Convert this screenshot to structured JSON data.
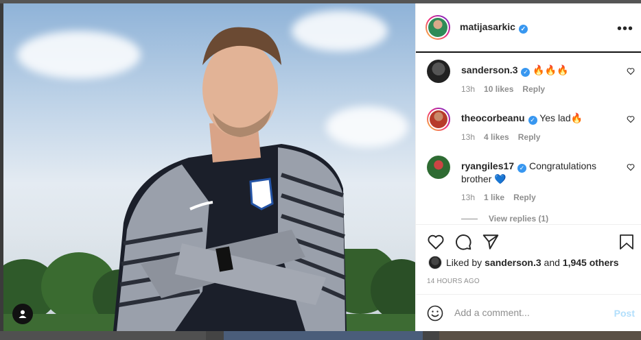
{
  "post": {
    "username": "matijasarkic",
    "more_label": "•••"
  },
  "comments": [
    {
      "username": "sanderson.3",
      "text": "🔥🔥🔥",
      "time": "13h",
      "likes": "10 likes",
      "reply": "Reply"
    },
    {
      "username": "theocorbeanu",
      "text": "Yes lad🔥",
      "time": "13h",
      "likes": "4 likes",
      "reply": "Reply"
    },
    {
      "username": "ryangiles17",
      "text": "Congratulations brother 💙",
      "time": "13h",
      "likes": "1 like",
      "reply": "Reply"
    }
  ],
  "view_replies": "View replies (1)",
  "liked_by": {
    "prefix": "Liked by ",
    "user": "sanderson.3",
    "middle": " and ",
    "others": "1,945 others"
  },
  "timestamp": "14 HOURS AGO",
  "add_comment": {
    "placeholder": "Add a comment...",
    "post_label": "Post"
  },
  "icons": [
    "heart-icon",
    "comment-icon",
    "share-icon",
    "bookmark-icon",
    "smile-icon",
    "more-icon",
    "verified-icon",
    "profile-icon"
  ],
  "colors": {
    "verified": "#3897f0",
    "post_disabled": "#b2dffc",
    "text": "#262626",
    "muted": "#8e8e8e"
  }
}
